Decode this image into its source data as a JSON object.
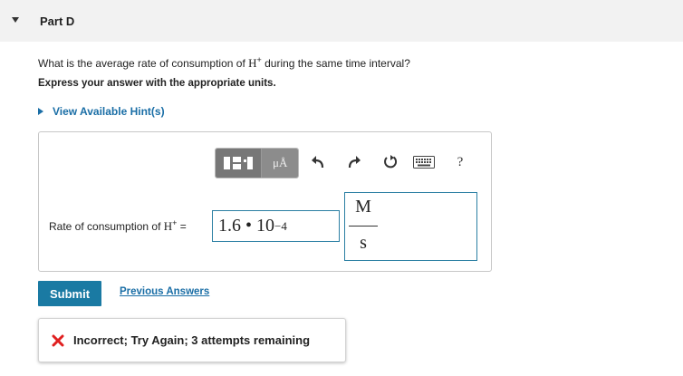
{
  "part": {
    "title": "Part D"
  },
  "question": {
    "text_before": "What is the average rate of consumption of ",
    "species": "H",
    "charge": "+",
    "text_after": " during the same time interval?"
  },
  "instruction": "Express your answer with the appropriate units.",
  "hint": {
    "label": "View Available Hint(s)"
  },
  "toolbar": {
    "units_label": "μÅ",
    "help_label": "?",
    "icons": [
      "templates-icon",
      "units-icon",
      "undo-icon",
      "redo-icon",
      "reset-icon",
      "keyboard-icon",
      "help-icon"
    ]
  },
  "answer": {
    "label_before": "Rate of consumption of ",
    "species": "H",
    "charge": "+",
    "equals": " =",
    "mantissa": "1.6",
    "times": " • ",
    "base": "10",
    "exponent": "−4",
    "unit_numerator": "M",
    "unit_denominator": "s"
  },
  "actions": {
    "submit_label": "Submit",
    "previous_answers_label": "Previous Answers"
  },
  "feedback": {
    "text": "Incorrect; Try Again; 3 attempts remaining",
    "color": "#e02020"
  },
  "colors": {
    "accent": "#1a7aa3",
    "link": "#1a6ea6"
  }
}
